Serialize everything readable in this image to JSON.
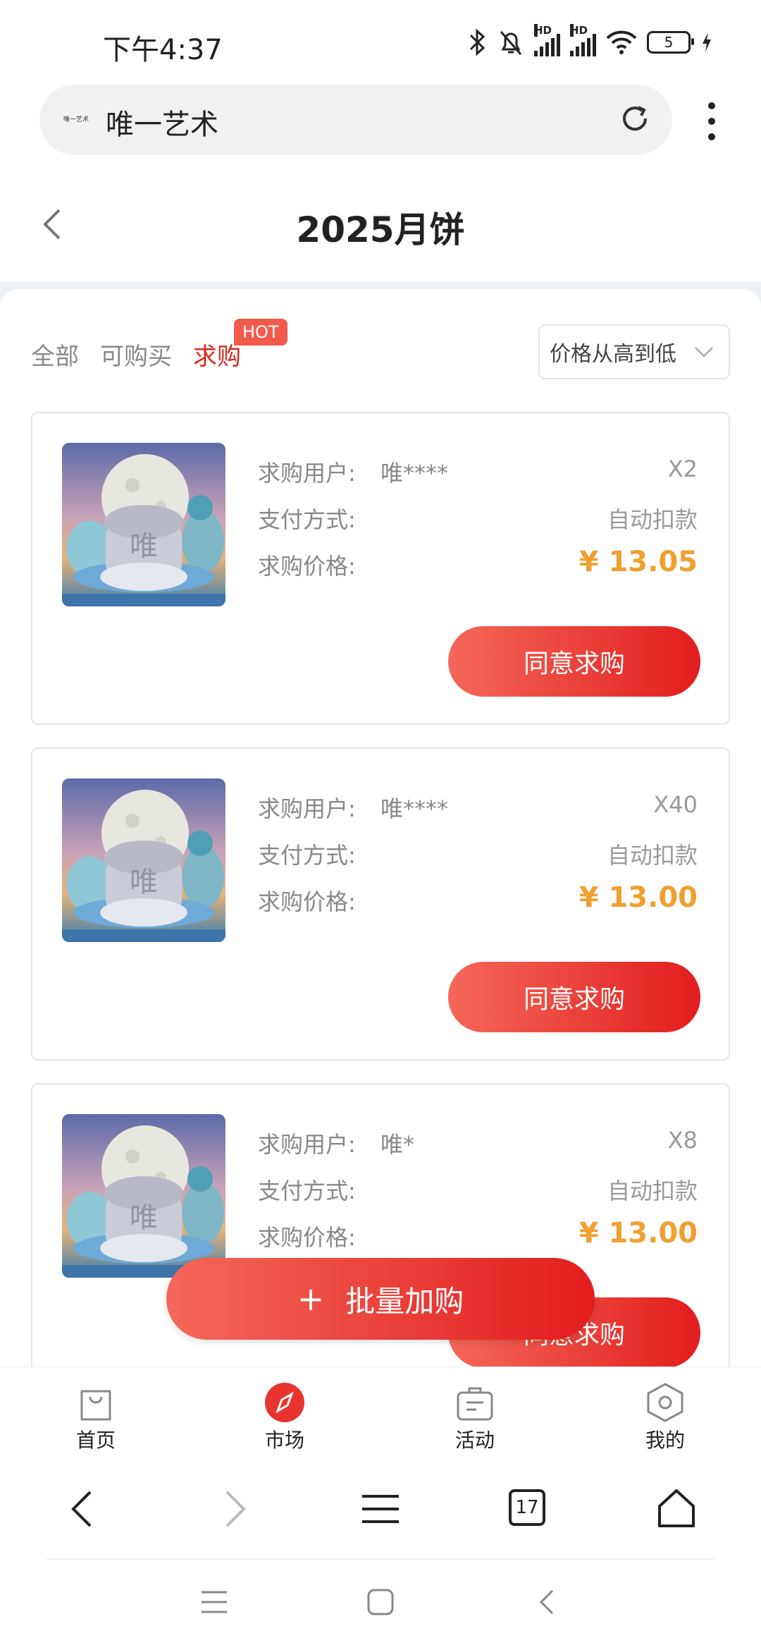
{
  "status_bar": {
    "time": "下午4:37",
    "battery": "5",
    "hd_label": "HD"
  },
  "browser": {
    "site_title": "唯一艺术",
    "site_logo_text": "唯一艺术",
    "tab_count": "17"
  },
  "header": {
    "title": "2025月饼"
  },
  "tabs": [
    {
      "label": "全部",
      "active": false
    },
    {
      "label": "可购买",
      "active": false
    },
    {
      "label": "求购",
      "active": true
    }
  ],
  "hot_badge": "HOT",
  "sort": {
    "selected": "价格从高到低"
  },
  "labels": {
    "user": "求购用户:",
    "payment": "支付方式:",
    "price": "求购价格:"
  },
  "cards": [
    {
      "user": "唯****",
      "qty": "X2",
      "payment": "自动扣款",
      "price": "¥ 13.05",
      "button": "同意求购"
    },
    {
      "user": "唯****",
      "qty": "X40",
      "payment": "自动扣款",
      "price": "¥ 13.00",
      "button": "同意求购"
    },
    {
      "user": "唯*",
      "qty": "X8",
      "payment": "自动扣款",
      "price": "¥ 13.00",
      "button": "同意求购"
    }
  ],
  "batch_button": {
    "plus": "+",
    "label": "批量加购"
  },
  "bottom_nav": [
    {
      "label": "首页",
      "icon": "shopping-bag-icon"
    },
    {
      "label": "市场",
      "icon": "compass-icon"
    },
    {
      "label": "活动",
      "icon": "briefcase-icon"
    },
    {
      "label": "我的",
      "icon": "hexagon-icon"
    }
  ],
  "colors": {
    "accent_red": "#e21d1d",
    "price_orange": "#f0a030",
    "active_tab": "#d9271d"
  }
}
